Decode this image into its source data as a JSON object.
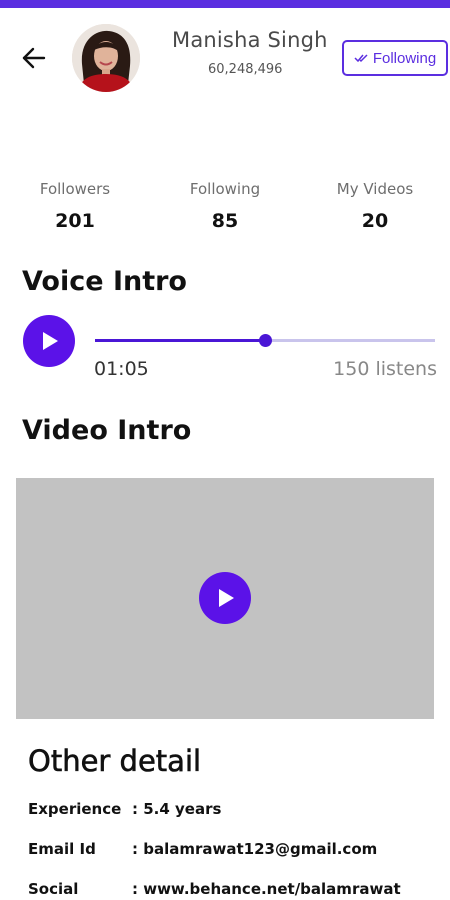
{
  "header": {
    "name": "Manisha Singh",
    "phone": "60,248,496",
    "follow_label": "Following",
    "accent": "#5b2ee0"
  },
  "stats": [
    {
      "label": "Followers",
      "value": "201"
    },
    {
      "label": "Following",
      "value": "85"
    },
    {
      "label": "My Videos",
      "value": "20"
    }
  ],
  "voice": {
    "title": "Voice Intro",
    "time": "01:05",
    "listens": "150 listens",
    "progress_fraction": 0.5
  },
  "video": {
    "title": "Video Intro"
  },
  "details": {
    "title": "Other detail",
    "rows": [
      {
        "key": "Experience",
        "value": ": 5.4 years"
      },
      {
        "key": "Email Id",
        "value": ": balamrawat123@gmail.com"
      },
      {
        "key": "Social",
        "value": ": www.behance.net/balamrawat"
      }
    ]
  },
  "icons": [
    "back-arrow-icon",
    "double-check-icon",
    "play-icon"
  ]
}
